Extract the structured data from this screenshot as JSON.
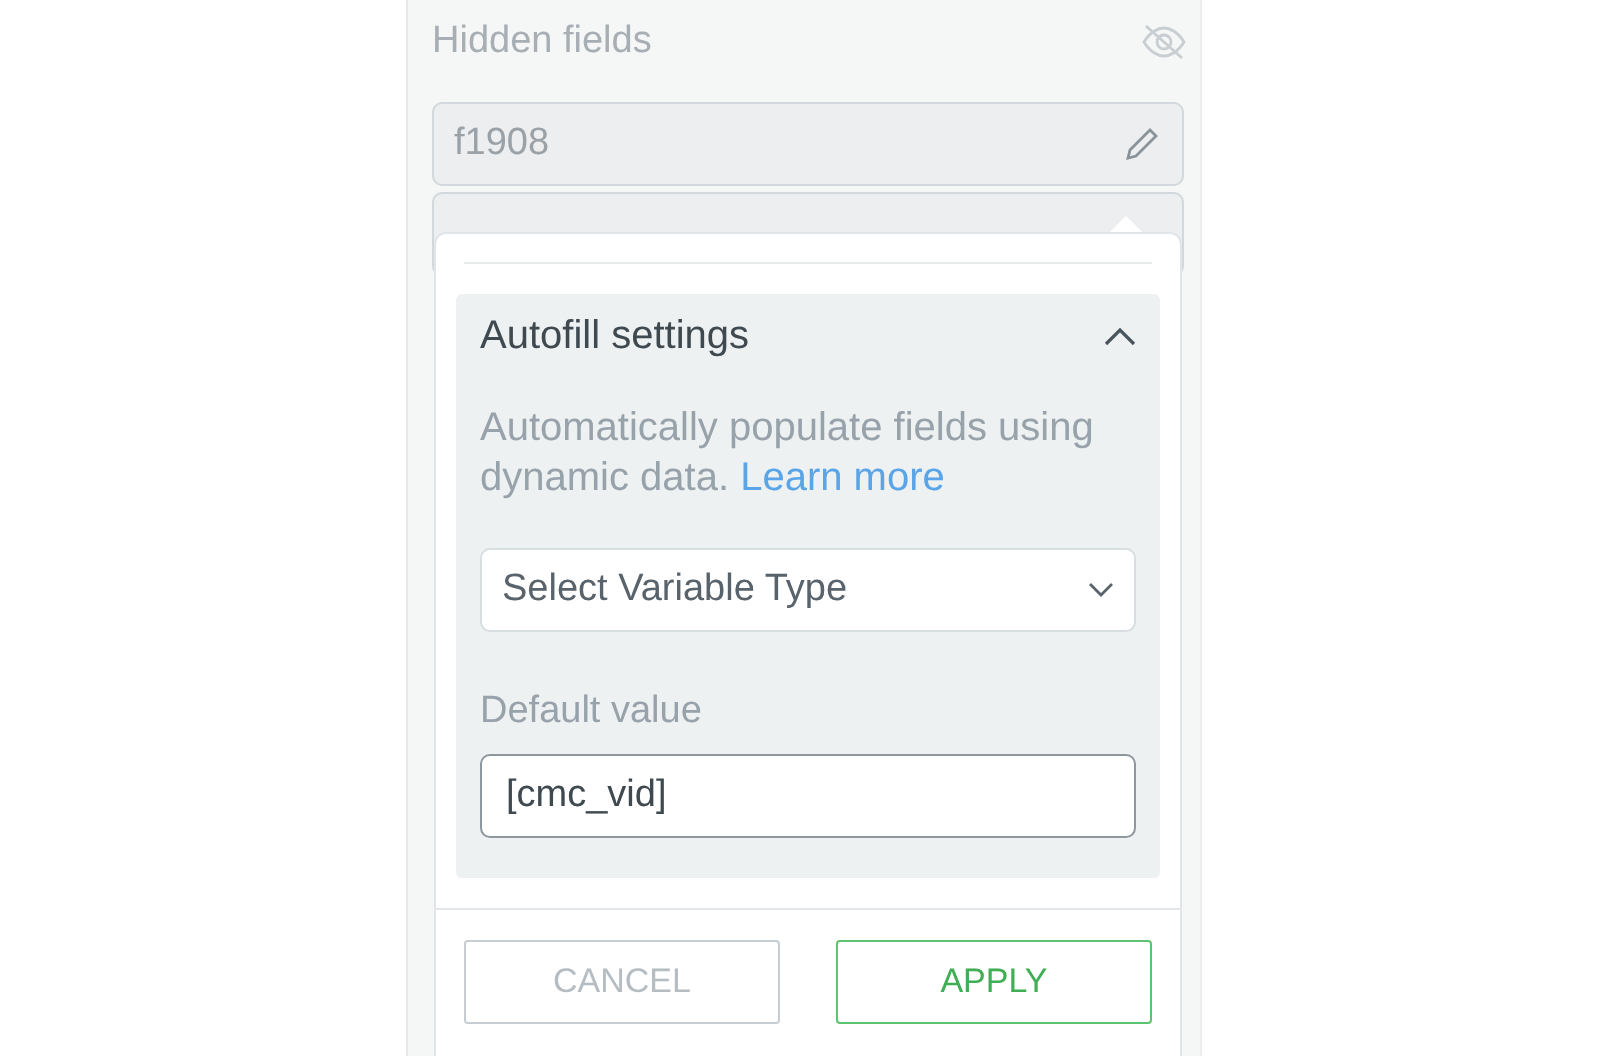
{
  "panel": {
    "title": "Hidden fields",
    "fields": [
      {
        "value": "f1908"
      }
    ]
  },
  "popup": {
    "section": {
      "title": "Autofill settings",
      "expanded": true,
      "description": "Automatically populate fields using dynamic data.",
      "link": "Learn more",
      "select": {
        "placeholder": "Select Variable Type"
      },
      "default_label": "Default value",
      "default_value": "[cmc_vid]"
    },
    "buttons": [
      {
        "label": "CANCEL",
        "kind": "secondary"
      },
      {
        "label": "APPLY",
        "kind": "primary"
      }
    ]
  }
}
